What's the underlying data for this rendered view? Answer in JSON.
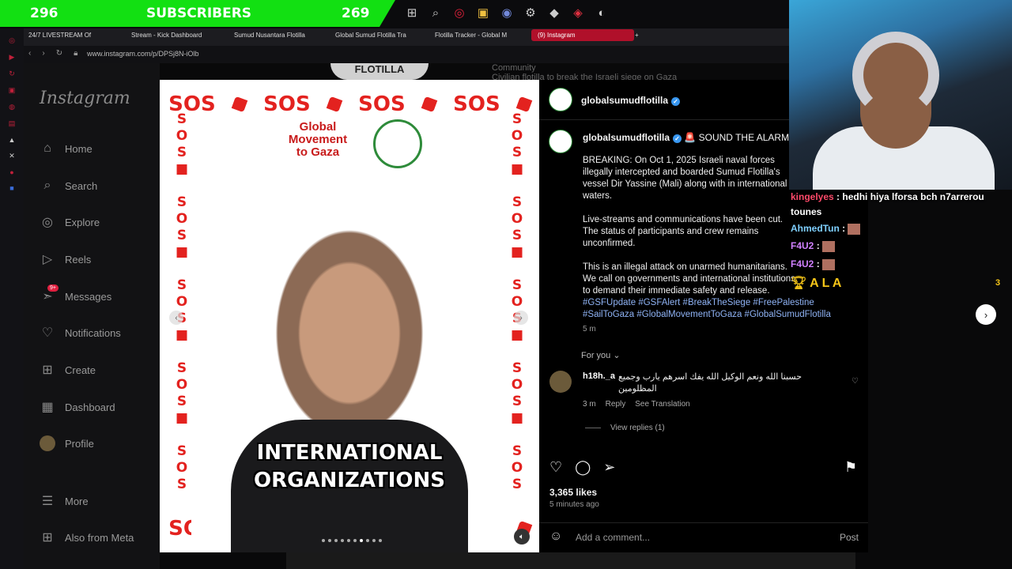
{
  "stream_overlay": {
    "left_count": "296",
    "label": "SUBSCRIBERS",
    "right_count": "269"
  },
  "tabs": [
    "24/7 LIVESTREAM Of",
    "Stream - Kick Dashboard",
    "Sumud Nusantara Flotilla",
    "Global Sumud Flotilla Tra",
    "Flotilla Tracker - Global M",
    "(9) Instagram"
  ],
  "url": "www.instagram.com/p/DPSj8N-iOlb",
  "bg": {
    "flotilla": "FLOTILLA",
    "community": "Community",
    "community_line": "Civilian flotilla to break the Israeli siege on Gaza"
  },
  "sidebar": {
    "logo": "Instagram",
    "items": [
      "Home",
      "Search",
      "Explore",
      "Reels",
      "Messages",
      "Notifications",
      "Create",
      "Dashboard",
      "Profile",
      "More",
      "Also from Meta"
    ],
    "messages_badge": "9+"
  },
  "media": {
    "sos": "SOS",
    "gm": "Global Movement to Gaza",
    "caption1": "INTERNATIONAL",
    "caption2": "ORGANIZATIONS"
  },
  "post": {
    "username": "globalsumudflotilla",
    "line1": "🚨 SOUND THE ALARM – II",
    "p1": "BREAKING: On Oct 1, 2025 Israeli naval forces illegally intercepted and boarded Sumud Flotilla's vessel Dir Yassine (Mali) along with in international waters.",
    "p2": "Live-streams and communications have been cut. The status of participants and crew remains unconfirmed.",
    "p3": "This is an illegal attack on unarmed humanitarians. We call on governments and international institutions to demand their immediate safety and release.",
    "tags": "#GSFUpdate #GSFAlert #BreakTheSiege #FreePalestine #SailToGaza #GlobalMovementToGaza #GlobalSumudFlotilla",
    "age": "5 m",
    "for_you": "For you",
    "comment": {
      "user": "h18h._a",
      "text": "حسبنا الله ونعم الوكيل الله يفك اسرهم يارب وجميع المظلومين",
      "age": "3 m",
      "reply": "Reply",
      "translate": "See Translation",
      "view_replies": "View replies (1)"
    },
    "likes": "3,365 likes",
    "time": "5 minutes ago",
    "add_comment": "Add a comment...",
    "post_btn": "Post"
  },
  "chat": [
    {
      "user": "kingelyes",
      "text": "hedhi hiya lforsa bch n7arrerou tounes"
    },
    {
      "user": "AhmedTun",
      "text": ":"
    },
    {
      "user": "F4U2",
      "text": ":"
    },
    {
      "user": "F4U2",
      "text": ":"
    },
    {
      "user": "A L A",
      "text": ""
    }
  ],
  "chat_count": "3",
  "colors": {
    "accent": "#e3221f",
    "link": "#8fb3f5",
    "sub_bar": "#12e012"
  }
}
